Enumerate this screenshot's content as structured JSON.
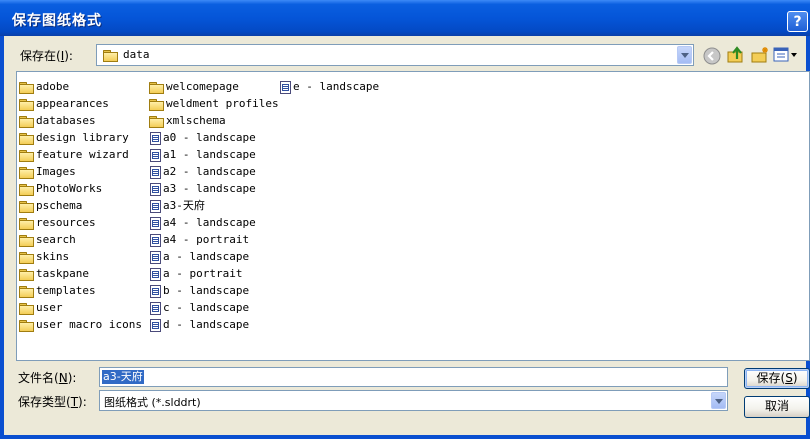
{
  "window": {
    "title": "保存图纸格式",
    "help_label": "?"
  },
  "location": {
    "label": "保存在",
    "accel": "I",
    "value": "data"
  },
  "toolbar": {
    "back_icon": "back-icon",
    "up_icon": "up-folder-icon",
    "new_folder_icon": "new-folder-icon",
    "views_icon": "views-menu-icon"
  },
  "files": {
    "col1": [
      "adobe",
      "appearances",
      "databases",
      "design library",
      "feature wizard",
      "Images",
      "PhotoWorks",
      "pschema",
      "resources",
      "search",
      "skins",
      "taskpane",
      "templates",
      "user",
      "user macro icons"
    ],
    "col2_folders": [
      "welcomepage",
      "weldment profiles",
      "xmlschema"
    ],
    "col2_docs": [
      "a0 - landscape",
      "a1 - landscape",
      "a2 - landscape",
      "a3 - landscape",
      "a3-天府",
      "a4 - landscape",
      "a4 - portrait",
      "a - landscape",
      "a - portrait",
      "b - landscape",
      "c - landscape",
      "d - landscape"
    ],
    "col3_docs": [
      "e - landscape"
    ]
  },
  "filename": {
    "label": "文件名",
    "accel": "N",
    "value": "a3-天府"
  },
  "filetype": {
    "label": "保存类型",
    "accel": "T",
    "value": "图纸格式 (*.slddrt)"
  },
  "buttons": {
    "save": "保存",
    "save_accel": "S",
    "cancel": "取消"
  },
  "colors": {
    "title_bar": "#0555D8",
    "selection": "#316AC5",
    "dialog_bg": "#ECE9D8"
  }
}
